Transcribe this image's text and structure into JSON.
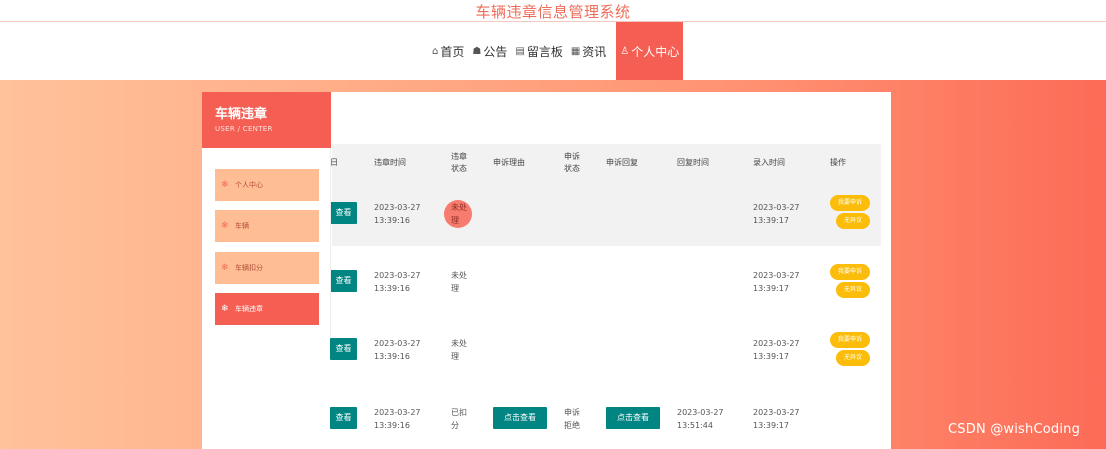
{
  "site": {
    "title": "车辆违章信息管理系统"
  },
  "nav": {
    "items": [
      {
        "icon": "⌂",
        "label": "首页"
      },
      {
        "icon": "☗",
        "label": "公告"
      },
      {
        "icon": "▤",
        "label": "留言板"
      },
      {
        "icon": "▦",
        "label": "资讯"
      }
    ],
    "active": {
      "icon": "♙",
      "label": "个人中心"
    }
  },
  "sidebar": {
    "title": "车辆违章",
    "subtitle": "USER / CENTER",
    "items": [
      {
        "label": "个人中心"
      },
      {
        "label": "车辆"
      },
      {
        "label": "车辆扣分"
      },
      {
        "label": "车辆违章"
      }
    ]
  },
  "table": {
    "headers": {
      "col0": "日",
      "violation_time": "违章时间",
      "violation_status": "违章\n状态",
      "appeal_reason": "申诉理由",
      "appeal_status": "申诉\n状态",
      "appeal_reply": "申诉回复",
      "reply_time": "回复时间",
      "entry_time": "录入时间",
      "actions": "操作"
    },
    "rows": [
      {
        "view": "查看",
        "violation_time": "2023-03-27\n13:39:16",
        "status": "未处\n理",
        "entry_time": "2023-03-27\n13:39:17",
        "action1": "我要申诉",
        "action2": "无异议"
      },
      {
        "view": "查看",
        "violation_time": "2023-03-27\n13:39:16",
        "status": "未处\n理",
        "entry_time": "2023-03-27\n13:39:17",
        "action1": "我要申诉",
        "action2": "无异议"
      },
      {
        "view": "查看",
        "violation_time": "2023-03-27\n13:39:16",
        "status": "未处\n理",
        "entry_time": "2023-03-27\n13:39:17",
        "action1": "我要申诉",
        "action2": "无异议"
      },
      {
        "view": "查看",
        "violation_time": "2023-03-27\n13:39:16",
        "status": "已扣\n分",
        "reason_btn": "点击查看",
        "appeal_status": "申诉\n拒绝",
        "reply_btn": "点击查看",
        "reply_time": "2023-03-27\n13:51:44",
        "entry_time": "2023-03-27\n13:39:17"
      }
    ]
  },
  "watermark": "CSDN @wishCoding",
  "colors": {
    "accent": "#f45e53",
    "teal": "#008583",
    "pill": "#fbbd0a",
    "side_item": "#ffbd93"
  }
}
